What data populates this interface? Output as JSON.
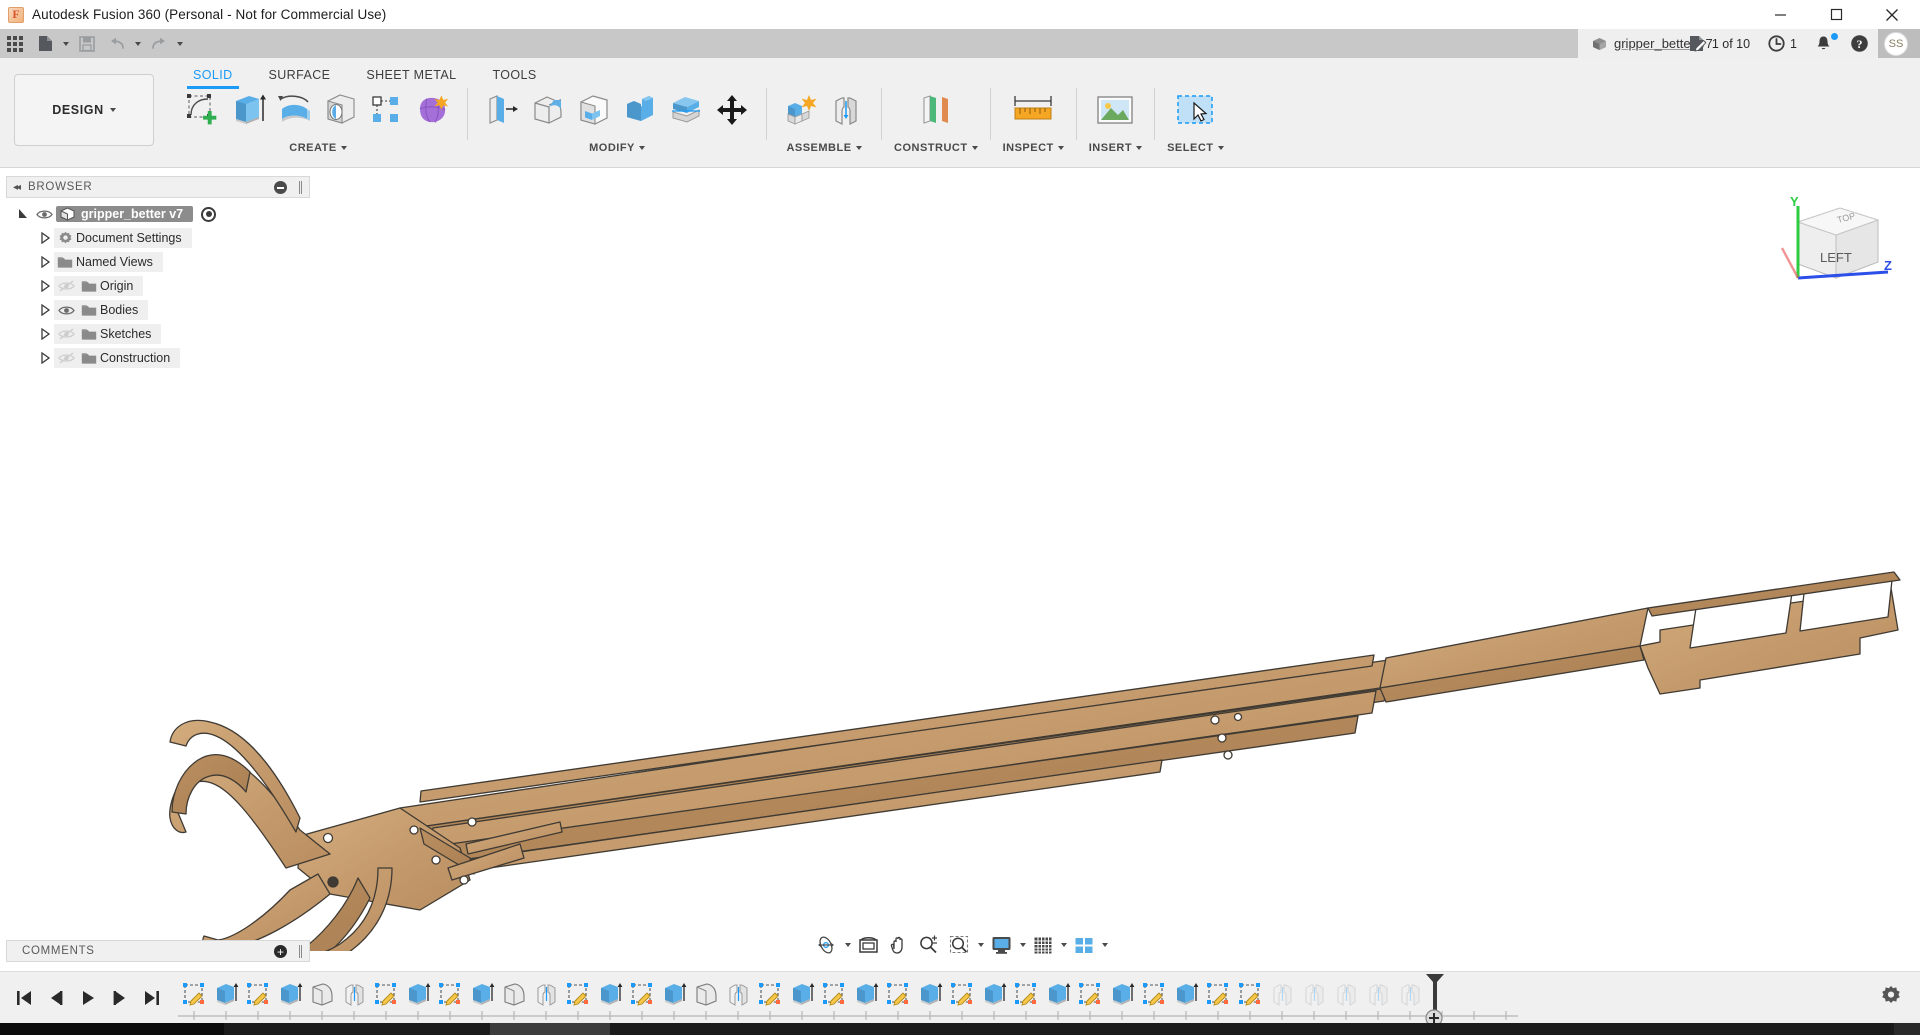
{
  "window": {
    "app_title": "Autodesk Fusion 360 (Personal - Not for Commercial Use)",
    "logo_letter": "F",
    "minimize": "minimize-icon",
    "maximize": "maximize-icon",
    "close": "close-icon"
  },
  "quick_access": {
    "apps_grid": "grid-apps-icon",
    "new_file": "new-file-icon",
    "save": "save-icon",
    "undo": "undo-icon",
    "redo": "redo-icon"
  },
  "document_tab": {
    "name": "gripper_better",
    "version": "v7",
    "close_label": "×",
    "new_tab_label": "+"
  },
  "tab_right": {
    "jobs_count": "1 of 10",
    "history_count": "1",
    "notifications": "bell-icon",
    "help": "help-icon",
    "avatar_initials": "SS"
  },
  "ribbon": {
    "workspace": "DESIGN",
    "tabs": [
      {
        "label": "SOLID",
        "active": true
      },
      {
        "label": "SURFACE",
        "active": false
      },
      {
        "label": "SHEET METAL",
        "active": false
      },
      {
        "label": "TOOLS",
        "active": false
      }
    ],
    "panels": [
      {
        "label": "CREATE",
        "has_dropdown": true,
        "tools": [
          "create-sketch-icon",
          "extrude-icon",
          "revolve-icon",
          "sweep-icon",
          "pattern-icon",
          "form-icon"
        ]
      },
      {
        "label": "MODIFY",
        "has_dropdown": true,
        "tools": [
          "press-pull-icon",
          "fillet-icon",
          "shell-icon",
          "combine-icon",
          "split-body-icon",
          "move-copy-icon"
        ]
      },
      {
        "label": "ASSEMBLE",
        "has_dropdown": true,
        "tools": [
          "new-component-icon",
          "joint-icon"
        ]
      },
      {
        "label": "CONSTRUCT",
        "has_dropdown": true,
        "tools": [
          "offset-plane-icon"
        ]
      },
      {
        "label": "INSPECT",
        "has_dropdown": true,
        "tools": [
          "measure-icon"
        ]
      },
      {
        "label": "INSERT",
        "has_dropdown": true,
        "tools": [
          "insert-canvas-icon"
        ]
      },
      {
        "label": "SELECT",
        "has_dropdown": true,
        "tools": [
          "select-window-icon"
        ]
      }
    ]
  },
  "browser": {
    "title": "BROWSER",
    "collapse_icon": "double-chevron-left-icon",
    "minimize_icon": "minimize-panel-icon",
    "root": {
      "label": "gripper_better v7",
      "visible": true,
      "selected": true,
      "icon": "component-cube-icon",
      "activate_icon": "radio-active-icon"
    },
    "items": [
      {
        "label": "Document Settings",
        "icon": "gear-icon",
        "has_eye": false,
        "eye_on": false
      },
      {
        "label": "Named Views",
        "icon": "folder-icon",
        "has_eye": false,
        "eye_on": false
      },
      {
        "label": "Origin",
        "icon": "folder-icon",
        "has_eye": true,
        "eye_on": false
      },
      {
        "label": "Bodies",
        "icon": "folder-icon",
        "has_eye": true,
        "eye_on": true
      },
      {
        "label": "Sketches",
        "icon": "folder-icon",
        "has_eye": true,
        "eye_on": false
      },
      {
        "label": "Construction",
        "icon": "folder-icon",
        "has_eye": true,
        "eye_on": false
      }
    ]
  },
  "viewcube": {
    "face_label": "LEFT",
    "axis_y": "Y",
    "axis_z": "Z",
    "axis_y_color": "#2ecc40",
    "axis_z_color": "#2b4fe8",
    "axis_x_color": "#e85b5b"
  },
  "comments": {
    "title": "COMMENTS",
    "add_icon": "add-comment-icon"
  },
  "navbar": {
    "items": [
      {
        "name": "orbit-icon",
        "has_caret": true
      },
      {
        "name": "look-at-icon",
        "has_caret": false
      },
      {
        "name": "pan-icon",
        "has_caret": false
      },
      {
        "name": "zoom-icon",
        "has_caret": false
      },
      {
        "name": "zoom-window-icon",
        "has_caret": true
      },
      {
        "name": "display-settings-icon",
        "has_caret": true
      },
      {
        "name": "grid-snaps-icon",
        "has_caret": true
      },
      {
        "name": "viewports-icon",
        "has_caret": true
      }
    ]
  },
  "timeline": {
    "playback": [
      "skip-to-start-icon",
      "step-back-icon",
      "play-icon",
      "step-forward-icon",
      "skip-to-end-icon"
    ],
    "features": [
      {
        "name": "sketch-icon",
        "type": "sketch",
        "ghost": false
      },
      {
        "name": "extrude-icon",
        "type": "extrude",
        "ghost": false
      },
      {
        "name": "sketch-icon",
        "type": "sketch",
        "ghost": false
      },
      {
        "name": "extrude-icon",
        "type": "extrude",
        "ghost": false
      },
      {
        "name": "fillet-icon",
        "type": "fillet",
        "ghost": false
      },
      {
        "name": "mirror-icon",
        "type": "mirror",
        "ghost": false
      },
      {
        "name": "sketch-icon",
        "type": "sketch",
        "ghost": false
      },
      {
        "name": "extrude-icon",
        "type": "extrude",
        "ghost": false
      },
      {
        "name": "sketch-icon",
        "type": "sketch",
        "ghost": false
      },
      {
        "name": "extrude-icon",
        "type": "extrude",
        "ghost": false
      },
      {
        "name": "fillet-icon",
        "type": "fillet",
        "ghost": false
      },
      {
        "name": "mirror-icon",
        "type": "mirror",
        "ghost": false
      },
      {
        "name": "sketch-icon",
        "type": "sketch",
        "ghost": false
      },
      {
        "name": "extrude-icon",
        "type": "extrude",
        "ghost": false
      },
      {
        "name": "sketch-icon",
        "type": "sketch",
        "ghost": false
      },
      {
        "name": "extrude-icon",
        "type": "extrude",
        "ghost": false
      },
      {
        "name": "fillet-icon",
        "type": "fillet",
        "ghost": false
      },
      {
        "name": "mirror-icon",
        "type": "mirror",
        "ghost": false
      },
      {
        "name": "sketch-icon",
        "type": "sketch",
        "ghost": false
      },
      {
        "name": "extrude-icon",
        "type": "extrude",
        "ghost": false
      },
      {
        "name": "sketch-icon",
        "type": "sketch",
        "ghost": false
      },
      {
        "name": "extrude-icon",
        "type": "extrude",
        "ghost": false
      },
      {
        "name": "sketch-icon",
        "type": "sketch",
        "ghost": false
      },
      {
        "name": "extrude-icon",
        "type": "extrude",
        "ghost": false
      },
      {
        "name": "sketch-icon",
        "type": "sketch",
        "ghost": false
      },
      {
        "name": "extrude-icon",
        "type": "extrude",
        "ghost": false
      },
      {
        "name": "sketch-icon",
        "type": "sketch",
        "ghost": false
      },
      {
        "name": "extrude-icon",
        "type": "extrude",
        "ghost": false
      },
      {
        "name": "sketch-icon",
        "type": "sketch",
        "ghost": false
      },
      {
        "name": "extrude-icon",
        "type": "extrude",
        "ghost": false
      },
      {
        "name": "sketch-icon",
        "type": "sketch",
        "ghost": false
      },
      {
        "name": "extrude-icon",
        "type": "extrude",
        "ghost": false
      },
      {
        "name": "sketch-icon",
        "type": "sketch",
        "ghost": false
      },
      {
        "name": "sketch-icon",
        "type": "sketch",
        "ghost": false
      },
      {
        "name": "mirror-icon",
        "type": "mirror",
        "ghost": true
      },
      {
        "name": "mirror-icon",
        "type": "mirror",
        "ghost": true
      },
      {
        "name": "mirror-icon",
        "type": "mirror",
        "ghost": true
      },
      {
        "name": "mirror-icon",
        "type": "mirror",
        "ghost": true
      },
      {
        "name": "mirror-icon",
        "type": "mirror",
        "ghost": true
      }
    ],
    "marker_position_index": 34,
    "add_marker_icon": "add-marker-icon",
    "settings_icon": "timeline-settings-icon"
  },
  "model": {
    "name": "gripper_better v7",
    "material_fill": "#c49a6c",
    "material_fill_light": "#d2ab7e",
    "material_fill_dark": "#a8815a",
    "outline": "#3a3a3a"
  },
  "colors": {
    "accent": "#1b9af7",
    "ribbon_bg": "#f0f0f0",
    "titlebar_bg": "#ffffff",
    "tabbar_bg": "#c8c8c8",
    "canvas_bg": "#ffffff",
    "timeline_bg": "#f0f0f0",
    "taskbar_bg": "#1b1b1b"
  }
}
